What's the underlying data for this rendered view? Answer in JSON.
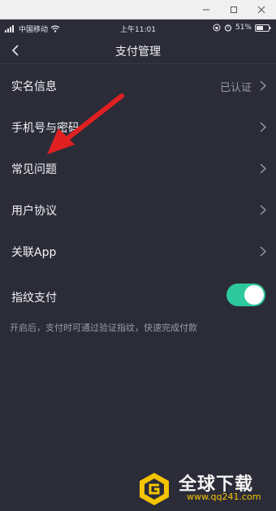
{
  "status_bar": {
    "carrier": "中国移动",
    "time": "上午11:01",
    "battery": "51%"
  },
  "nav": {
    "title": "支付管理"
  },
  "menu": {
    "items": [
      {
        "label": "实名信息",
        "value": "已认证"
      },
      {
        "label": "手机号与密码",
        "value": ""
      },
      {
        "label": "常见问题",
        "value": ""
      },
      {
        "label": "用户协议",
        "value": ""
      },
      {
        "label": "关联App",
        "value": ""
      }
    ]
  },
  "fingerprint": {
    "label": "指纹支付",
    "enabled": true,
    "hint": "开启后，支付时可通过验证指纹，快速完成付款"
  },
  "watermark": {
    "title": "全球下载",
    "url": "www.qq241.com"
  },
  "colors": {
    "background": "#2b2c38",
    "toggle_on": "#2dc99c",
    "arrow": "#e02020",
    "watermark_accent": "#f5c400"
  }
}
